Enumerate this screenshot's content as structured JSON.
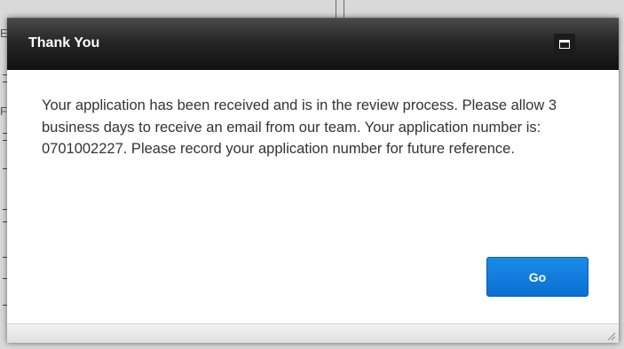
{
  "dialog": {
    "title": "Thank You",
    "message": "Your application has been received and is in the review process. Please allow 3 business days to receive an email from our team. Your application number is: 0701002227. Please record your application number for future reference.",
    "go_label": "Go",
    "maximize_icon": "maximize-icon",
    "resize_icon": "resize-grip-icon"
  },
  "background": {
    "fragment_letter_1": "E",
    "fragment_letter_2": "F"
  },
  "colors": {
    "titlebar": "#1a1a1a",
    "title_text": "#ffffff",
    "body_text": "#333333",
    "button": "#0b70d2"
  }
}
